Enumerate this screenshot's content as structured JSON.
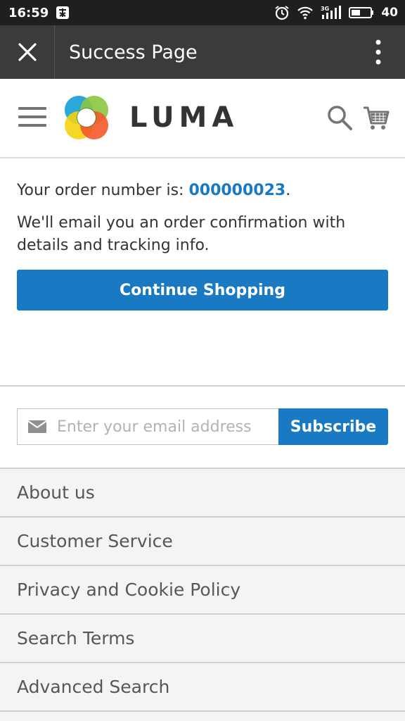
{
  "status_bar": {
    "time": "16:59",
    "battery": "40",
    "network": "3G"
  },
  "app_bar": {
    "title": "Success Page"
  },
  "header": {
    "logo_text": "LUMA"
  },
  "order": {
    "prefix": "Your order number is: ",
    "number": "000000023",
    "suffix": ".",
    "email_note": "We'll email you an order confirmation with details and tracking info.",
    "continue_label": "Continue Shopping"
  },
  "newsletter": {
    "placeholder": "Enter your email address",
    "subscribe_label": "Subscribe"
  },
  "footer": {
    "links": [
      "About us",
      "Customer Service",
      "Privacy and Cookie Policy",
      "Search Terms",
      "Advanced Search"
    ]
  },
  "colors": {
    "accent": "#1979c3",
    "app_bar": "#3a3b3d",
    "status_bar": "#1f1f1f",
    "footer_bg": "#f4f4f4"
  }
}
